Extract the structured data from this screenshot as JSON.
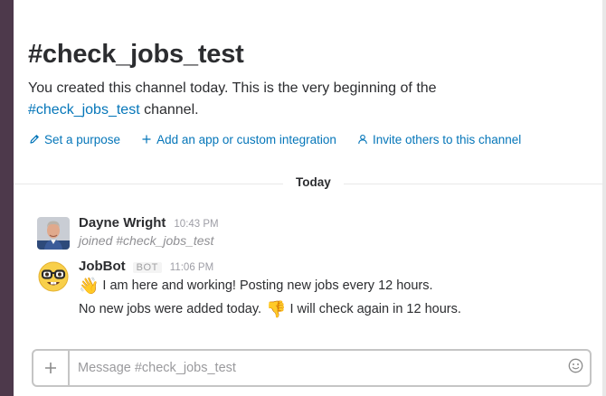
{
  "channel": {
    "title": "#check_jobs_test",
    "intro_text": "You created this channel today. This is the very beginning of the",
    "intro_link": "#check_jobs_test",
    "intro_suffix": " channel."
  },
  "actions": [
    {
      "label": "Set a purpose",
      "icon": "pencil-icon"
    },
    {
      "label": "Add an app or custom integration",
      "icon": "plus-icon"
    },
    {
      "label": "Invite others to this channel",
      "icon": "person-icon"
    }
  ],
  "day_divider": "Today",
  "messages": [
    {
      "sender": "Dayne Wright",
      "time": "10:43 PM",
      "lines": [
        "joined #check_jobs_test"
      ]
    },
    {
      "sender": "JobBot",
      "badge": "BOT",
      "time": "11:06 PM",
      "avatar_icon": "nerd-face-icon",
      "line1_emoji": "👋",
      "line1_text": "I am here and working! Posting new jobs every 12 hours.",
      "line2_text_a": "No new jobs were added today.",
      "line2_emoji": "👎",
      "line2_text_b": "I will check again in 12 hours."
    }
  ],
  "composer": {
    "placeholder": "Message #check_jobs_test",
    "add_icon": "plus-icon",
    "emoji_icon": "smiley-icon"
  },
  "colors": {
    "sidebar": "#4d394b",
    "link": "#0576b9",
    "text": "#2c2d30"
  }
}
